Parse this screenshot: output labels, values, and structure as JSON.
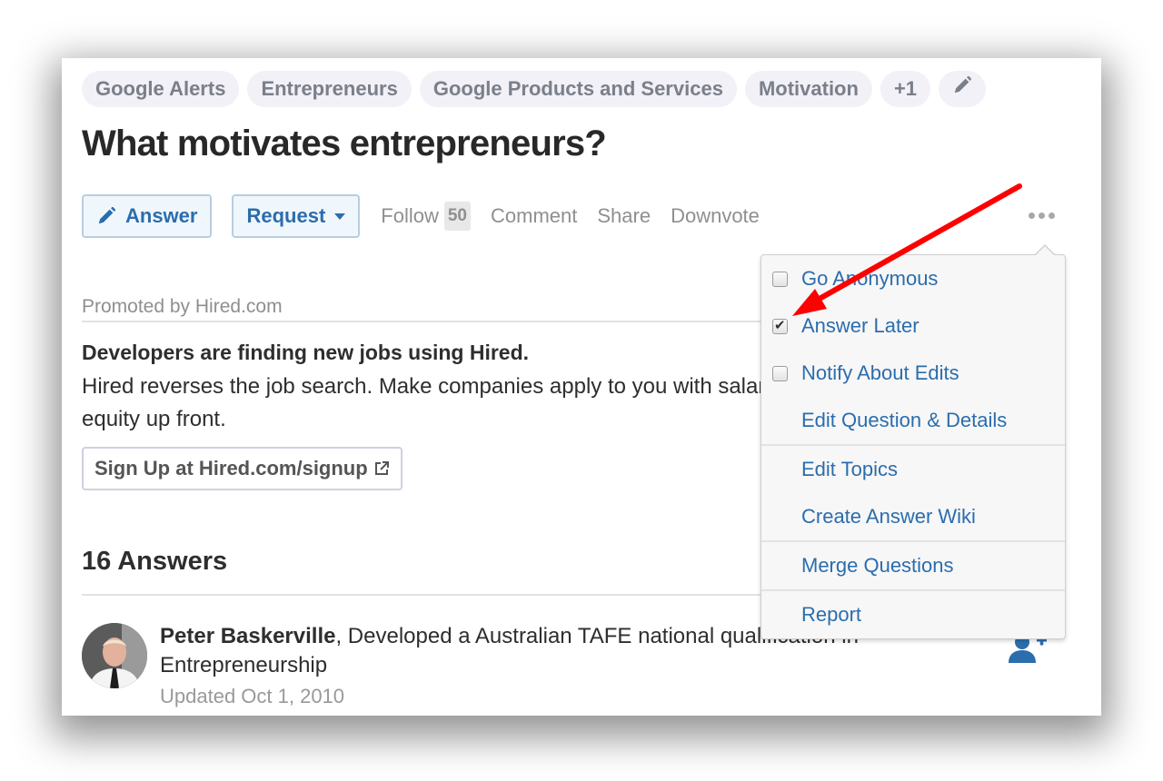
{
  "topics": [
    {
      "label": "Google Alerts"
    },
    {
      "label": "Entrepreneurs"
    },
    {
      "label": "Google Products and Services"
    },
    {
      "label": "Motivation"
    },
    {
      "label": "+1"
    }
  ],
  "topics_edit_icon": "pencil-icon",
  "question": {
    "title": "What motivates entrepreneurs?"
  },
  "actions": {
    "answer_label": "Answer",
    "request_label": "Request",
    "follow_label": "Follow",
    "follow_count": "50",
    "comment_label": "Comment",
    "share_label": "Share",
    "downvote_label": "Downvote",
    "more_icon": "ellipsis-icon"
  },
  "promoted": {
    "label": "Promoted by Hired.com",
    "headline": "Developers are finding new jobs using Hired.",
    "body": "Hired reverses the job search. Make companies apply to you with salary and equity up front.",
    "cta_label": "Sign Up at Hired.com/signup"
  },
  "answers": {
    "heading": "16 Answers",
    "items": [
      {
        "author": "Peter Baskerville",
        "credential": ", Developed a Australian TAFE national qualification in Entrepreneurship",
        "updated": "Updated Oct 1, 2010"
      }
    ]
  },
  "menu": {
    "groups": [
      [
        {
          "label": "Go Anonymous",
          "checkbox": true,
          "checked": false
        },
        {
          "label": "Answer Later",
          "checkbox": true,
          "checked": true
        },
        {
          "label": "Notify About Edits",
          "checkbox": true,
          "checked": false
        },
        {
          "label": "Edit Question & Details",
          "checkbox": false
        }
      ],
      [
        {
          "label": "Edit Topics",
          "checkbox": false
        },
        {
          "label": "Create Answer Wiki",
          "checkbox": false
        }
      ],
      [
        {
          "label": "Merge Questions",
          "checkbox": false
        }
      ],
      [
        {
          "label": "Report",
          "checkbox": false
        }
      ]
    ]
  },
  "colors": {
    "link_blue": "#2b6dad",
    "annotation_red": "#ff0000",
    "topic_bg": "#f1f1f7",
    "text_dark": "#282829",
    "muted": "#8f8f8f"
  }
}
